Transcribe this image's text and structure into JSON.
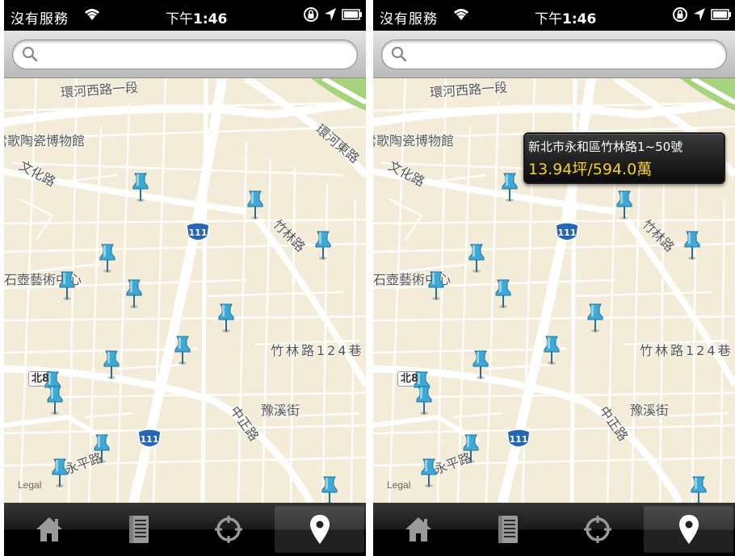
{
  "status_bar": {
    "carrier": "沒有服務",
    "time_prefix": "下午",
    "time": "1:46"
  },
  "search": {
    "placeholder": ""
  },
  "map": {
    "labels": {
      "road_top": "環河西路一段",
      "ceramics_museum": "鶯歌陶瓷博物館",
      "wenhua_road": "文化路",
      "huanhe_east": "環河東路",
      "zhulin_road": "竹林路",
      "art_center": "華石壺藝術中心",
      "zhulin_lane": "竹林路124巷",
      "yuxi_street": "豫溪街",
      "zhongzheng_road": "中正路",
      "yongping_road": "永平路",
      "north_shield": "北8"
    },
    "highway_number": "111",
    "legal": "Legal"
  },
  "callout": {
    "address": "新北市永和區竹林路1~50號",
    "value": "13.94坪/594.0萬"
  },
  "tabs": [
    {
      "icon": "home-icon"
    },
    {
      "icon": "list-icon"
    },
    {
      "icon": "locate-icon"
    },
    {
      "icon": "map-pin-icon",
      "selected": true
    }
  ],
  "colors": {
    "pin": "#3fa9d6",
    "callout_value": "#f5d31b",
    "map_bg": "#f3ecd8",
    "road": "#ffffff"
  }
}
